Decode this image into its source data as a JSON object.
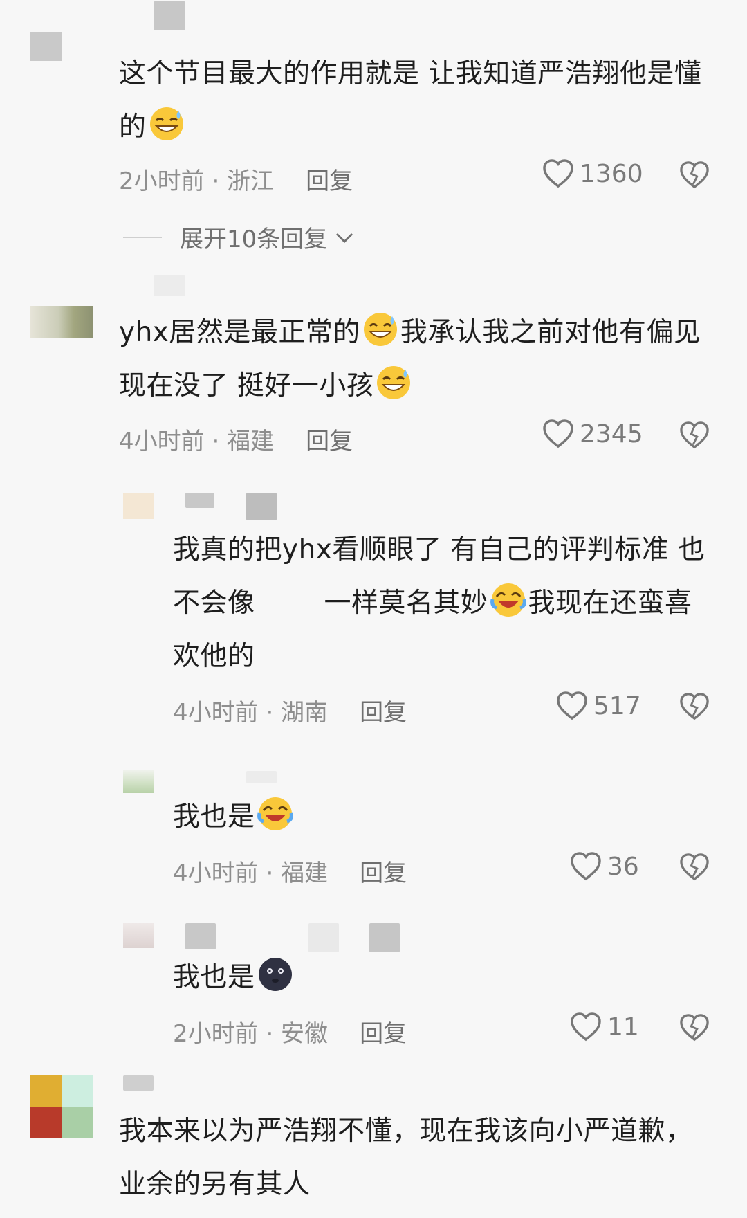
{
  "comments": [
    {
      "text": "这个节目最大的作用就是 让我知道严浩翔他是懂的",
      "time": "2小时前 · 浙江",
      "reply_label": "回复",
      "likes": "1360",
      "expand_label": "展开10条回复",
      "emoji": "grinning-sweat-emoji"
    },
    {
      "text_a": "yhx居然是最正常的",
      "text_b": "我承认我之前对他有偏见现在没了 挺好一小孩",
      "time": "4小时前 · 福建",
      "reply_label": "回复",
      "likes": "2345",
      "emoji": "grinning-sweat-emoji"
    },
    {
      "text_a": "我真的把yhx看顺眼了 有自己的评判标准 也不会像",
      "text_b": "一样莫名其妙",
      "text_c": "我现在还蛮喜欢他的",
      "time": "4小时前 · 湖南",
      "reply_label": "回复",
      "likes": "517",
      "emoji": "crying-laughing-emoji"
    },
    {
      "text": "我也是",
      "time": "4小时前 · 福建",
      "reply_label": "回复",
      "likes": "36",
      "emoji": "crying-laughing-emoji"
    },
    {
      "text": "我也是",
      "time": "2小时前 · 安徽",
      "reply_label": "回复",
      "likes": "11",
      "emoji": "dark-moon-face-emoji"
    },
    {
      "text": "我本来以为严浩翔不懂，现在我该向小严道歉，业余的另有其人"
    }
  ],
  "colors": {
    "background": "#f7f7f7",
    "text": "#1e1e1e",
    "meta": "#8e8e8e",
    "emoji_yellow": "#f9c83a"
  }
}
